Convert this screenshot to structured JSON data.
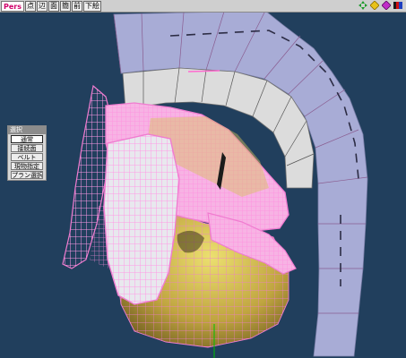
{
  "toolbar": {
    "view_mode": "Pers",
    "buttons": [
      "点",
      "辺",
      "面",
      "簡",
      "前",
      "下絵"
    ],
    "nav_icons": [
      "move-icon",
      "zoom-icon",
      "rotate-icon"
    ]
  },
  "select_panel": {
    "title": "選択",
    "items": [
      "通常",
      "接続面",
      "ベルト",
      "現物指定",
      "プラン選択"
    ],
    "active_index": 0
  },
  "colors": {
    "background": "#213f5d",
    "crest_outer": "#a8acd6",
    "crest_inner": "#d8d8d8",
    "wireframe": "#f07cd0",
    "face": "#b8a23a"
  }
}
